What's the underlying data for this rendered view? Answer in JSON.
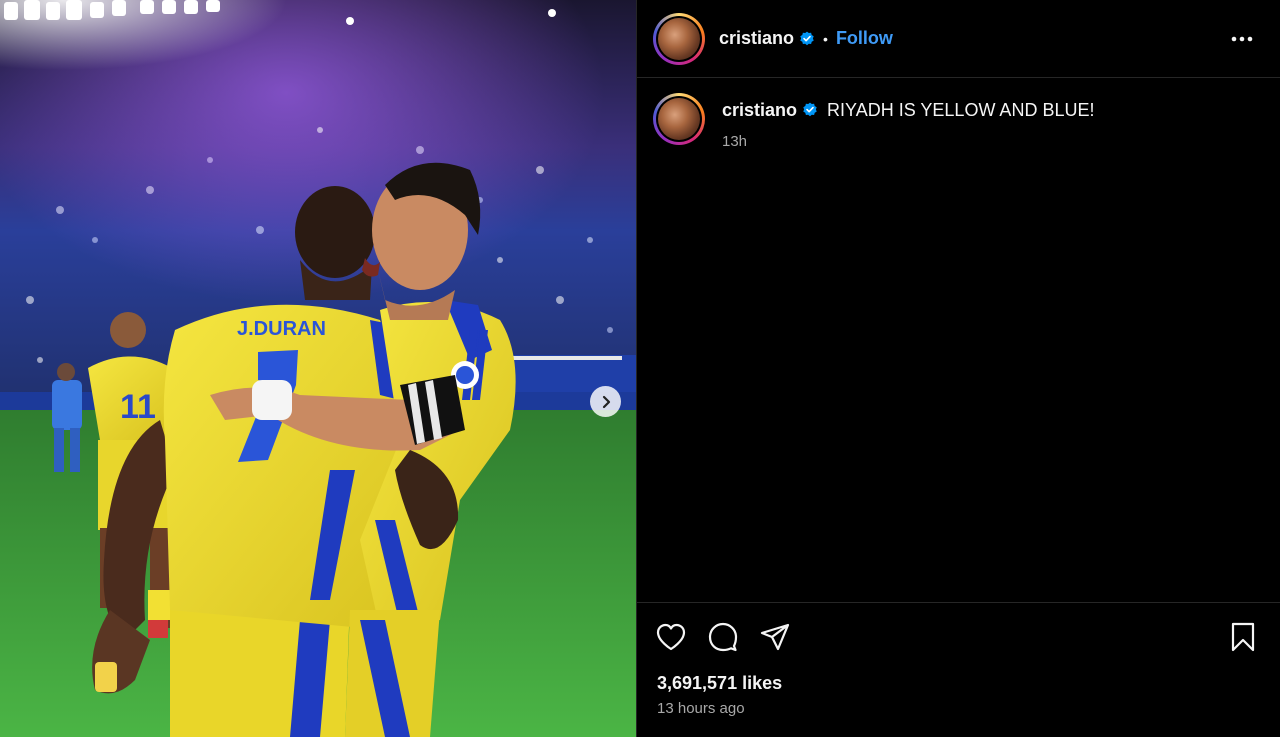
{
  "header": {
    "username": "cristiano",
    "separator": "•",
    "follow_label": "Follow",
    "avatar_icon": "profile-avatar",
    "verified_icon": "verified-badge-icon",
    "more_icon": "more-options-icon"
  },
  "post": {
    "jersey_name": "J.DURAN",
    "caption_user": "cristiano",
    "caption_text": "RIYADH IS YELLOW AND BLUE!",
    "caption_time": "13h",
    "likes": "3,691,571 likes",
    "posted_ago": "13 hours ago"
  },
  "actions": {
    "like_icon": "heart-icon",
    "comment_icon": "comment-icon",
    "share_icon": "share-icon",
    "save_icon": "bookmark-icon",
    "next_icon": "chevron-right-icon"
  },
  "colors": {
    "follow_blue": "#3f9bf7",
    "verified_blue": "#0095f6",
    "jersey_yellow": "#f2e033",
    "jersey_blue": "#1f3bbf",
    "pitch_green": "#3f9e3a"
  }
}
